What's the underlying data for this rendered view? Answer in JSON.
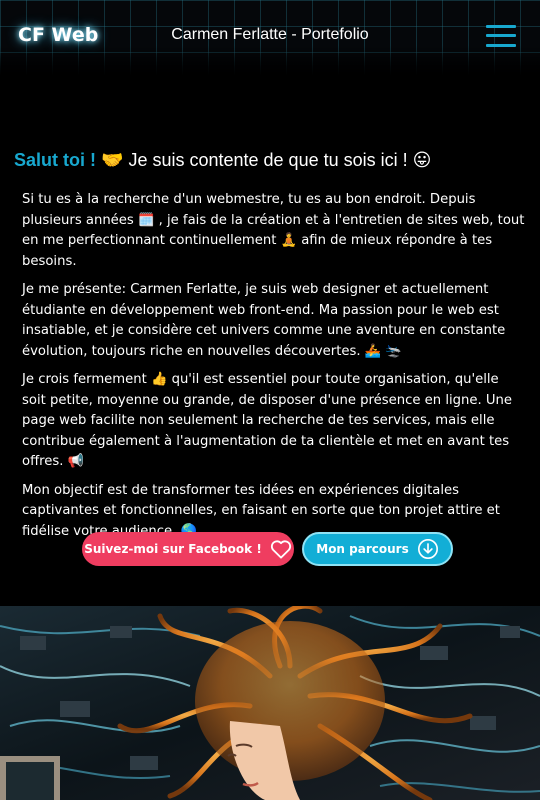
{
  "header": {
    "logo": "CF Web",
    "title": "Carmen Ferlatte - Portefolio",
    "menu_icon": "hamburger-menu-icon"
  },
  "greeting": {
    "hello": "Salut toi !",
    "hello_emoji": "🤝",
    "rest": "Je suis contente de que tu sois ici !",
    "rest_emoji": "😛"
  },
  "paragraphs": [
    "Si tu es à la recherche d'un webmestre, tu es au bon endroit. Depuis plusieurs années 🗓️ , je fais de la création et à l'entretien de sites web, tout en me perfectionnant continuellement 🧘 afin de mieux répondre à tes besoins.",
    "Je me présente: Carmen Ferlatte, je suis web designer et actuellement étudiante en développement web front-end. Ma passion pour le web est insatiable, et je considère cet univers comme une aventure en constante évolution, toujours riche en nouvelles découvertes. 🚣 🛬",
    "Je crois fermement 👍 qu'il est essentiel pour toute organisation, qu'elle soit petite, moyenne ou grande, de disposer d'une présence en ligne. Une page web facilite non seulement la recherche de tes services, mais elle contribue également à l'augmentation de ta clientèle et met en avant tes offres. 📢",
    "Mon objectif est de transformer tes idées en expériences digitales captivantes et fonctionnelles, en faisant en sorte que ton projet attire et fidélise votre audience. 🌎"
  ],
  "buttons": {
    "facebook": {
      "label": "Suivez-moi sur Facebook !",
      "icon": "heart-outline-icon"
    },
    "parcours": {
      "label": "Mon parcours",
      "icon": "download-circle-icon"
    }
  },
  "colors": {
    "accent": "#18a8cf",
    "facebook_button": "#ef3d60",
    "parcours_button": "#12aed6",
    "background": "#000000"
  }
}
